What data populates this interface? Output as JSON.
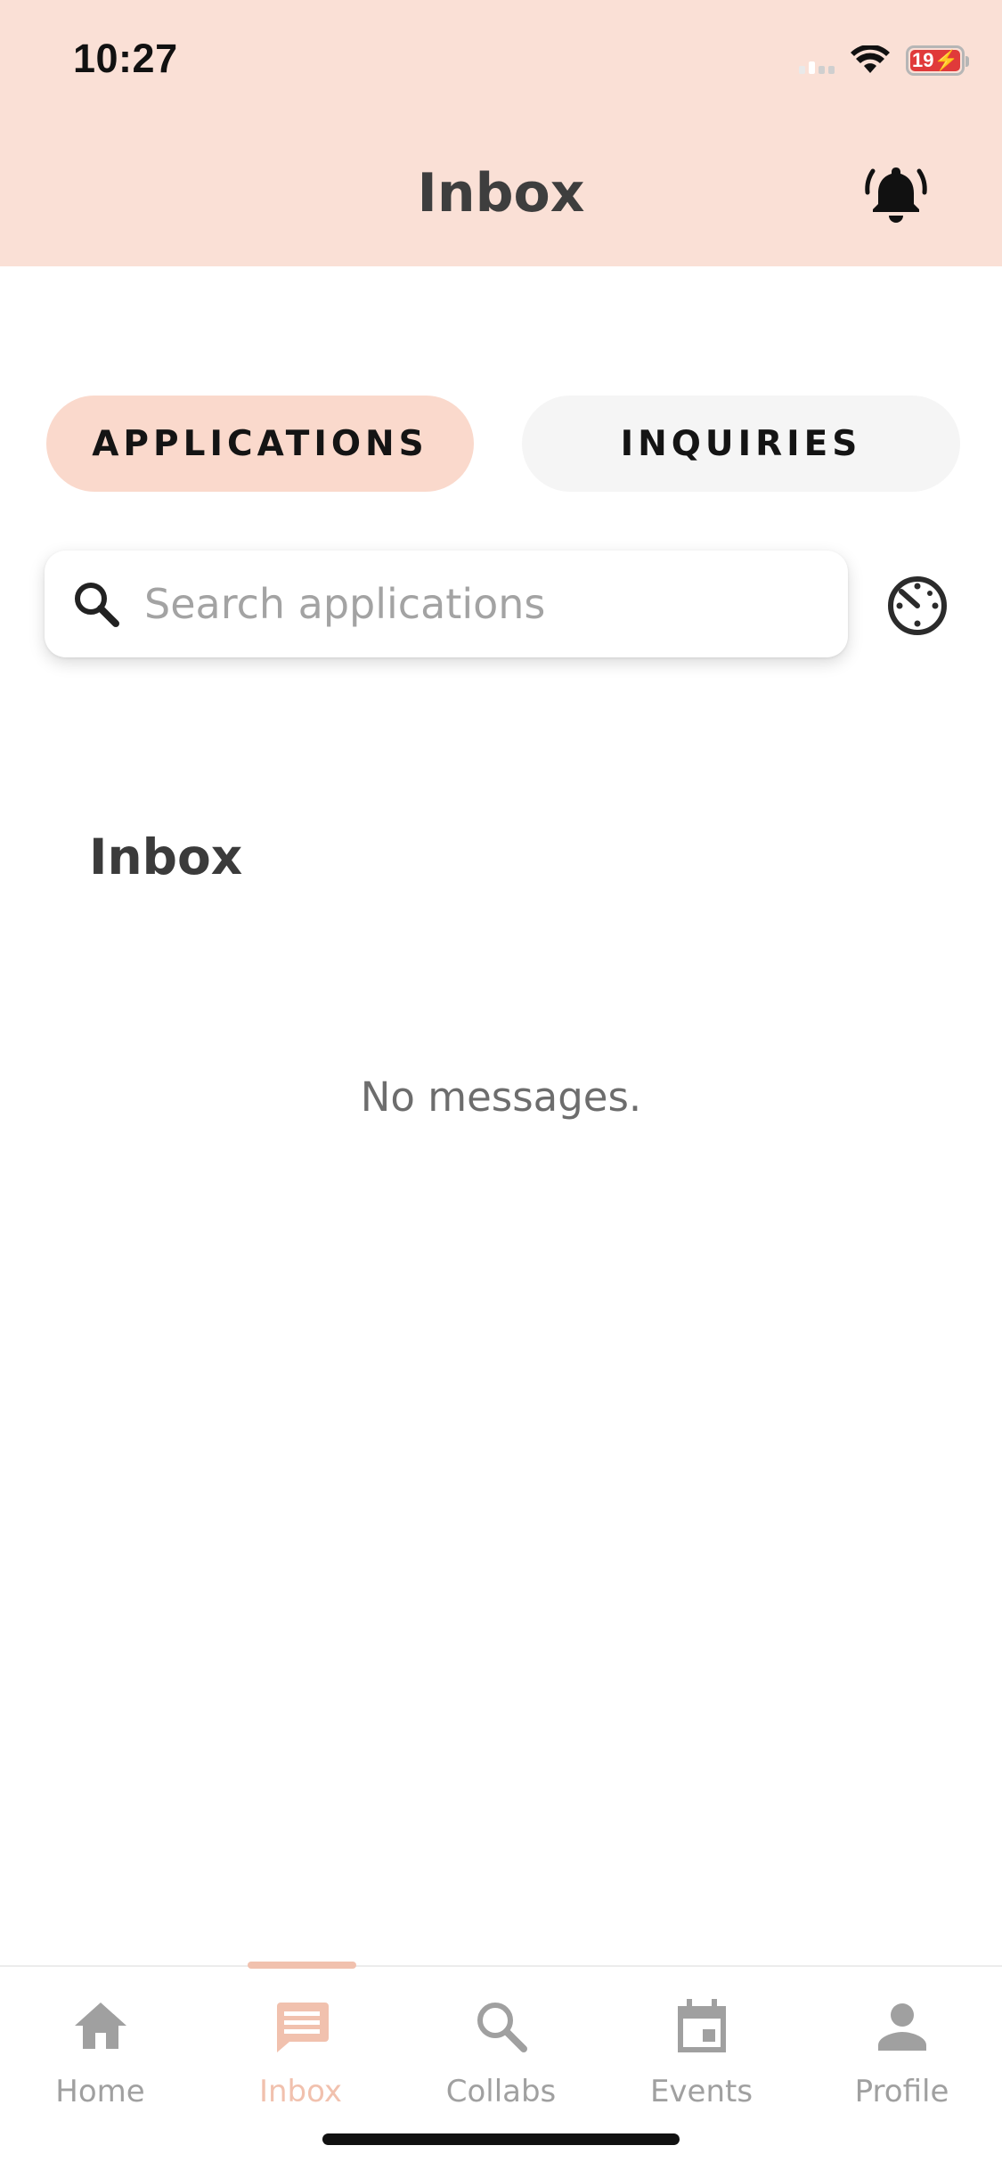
{
  "status_bar": {
    "time": "10:27",
    "battery": "19"
  },
  "header": {
    "title": "Inbox",
    "notification_icon": "bell-ringing-icon"
  },
  "tabs": [
    {
      "label": "APPLICATIONS",
      "active": true
    },
    {
      "label": "INQUIRIES",
      "active": false
    }
  ],
  "search": {
    "placeholder": "Search applications",
    "value": "",
    "icon": "search-icon",
    "filter_icon": "timer-icon"
  },
  "section": {
    "title": "Inbox",
    "empty_message": "No messages."
  },
  "bottom_nav": {
    "items": [
      {
        "label": "Home",
        "icon": "home-icon",
        "active": false
      },
      {
        "label": "Inbox",
        "icon": "chat-icon",
        "active": true
      },
      {
        "label": "Collabs",
        "icon": "search-icon",
        "active": false
      },
      {
        "label": "Events",
        "icon": "calendar-icon",
        "active": false
      },
      {
        "label": "Profile",
        "icon": "person-icon",
        "active": false
      }
    ]
  },
  "colors": {
    "header_bg": "#fae0d6",
    "active_tab_bg": "#fad9cc",
    "inactive_tab_bg": "#f5f5f5",
    "accent": "#f1c1ae",
    "inactive_nav": "#a0a0a0",
    "battery_low": "#e03a3a"
  }
}
